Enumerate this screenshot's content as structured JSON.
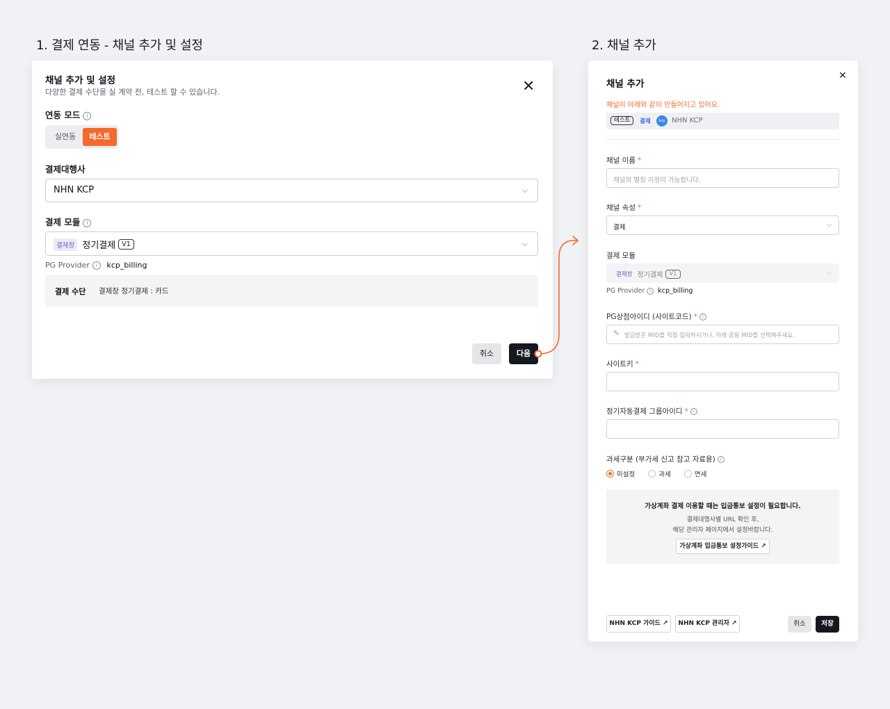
{
  "steps": {
    "step1_title": "1. 결제 연동 - 채널 추가 및 설정",
    "step2_title": "2. 채널 추가"
  },
  "card1": {
    "title": "채널 추가 및 설정",
    "subtitle": "다양한 결제 수단을 실 계약 전, 테스트 할 수 있습니다.",
    "close": "✕",
    "mode_label": "연동 모드",
    "mode_options": [
      "실연동",
      "테스트"
    ],
    "mode_selected": "테스트",
    "pg_label": "결제대행사",
    "pg_value": "NHN KCP",
    "module_label": "결제 모듈",
    "module_tag": "결제창",
    "module_value": "정기결제",
    "module_version": "V1",
    "provider_label": "PG Provider",
    "provider_value": "kcp_billing",
    "method_key": "결제 수단",
    "method_value": "결제창 정기결제 : 카드",
    "cancel": "취소",
    "next": "다음"
  },
  "card2": {
    "title": "채널 추가",
    "close": "✕",
    "warn": "채널이 아래와 같이 만들어지고 있어요.",
    "preview": {
      "mode": "테스트",
      "type": "결제",
      "logo": "kcp",
      "pg": "NHN KCP"
    },
    "name_label": "채널 이름",
    "name_placeholder": "채널의 별칭 지정이 가능합니다.",
    "attr_label": "채널 속성",
    "attr_value": "결제",
    "module_label": "결제 모듈",
    "module_tag": "결제창",
    "module_value": "정기결제",
    "module_version": "V1",
    "provider_label": "PG Provider",
    "provider_value": "kcp_billing",
    "mid_label": "PG상점아이디 (사이트코드)",
    "mid_placeholder": "발급받은 MID를 직접 입력하시거나, 아래 공용 MID를 선택해주세요.",
    "sitekey_label": "사이트키",
    "group_label": "정기자동결제 그룹아이디",
    "tax_label": "과세구분 (부가세 신고 참고 자료용)",
    "tax_options": [
      "미설정",
      "과세",
      "면세"
    ],
    "tax_selected": "미설정",
    "notice_title": "가상계좌 결제 이용할 때는 입금통보 설정이 필요합니다.",
    "notice_line1": "결제대행사별 URL 확인 후,",
    "notice_line2": "해당 관리자 페이지에서 설정바랍니다.",
    "notice_button": "가상계좌 입금통보 설정가이드 ↗",
    "guide_button": "NHN KCP 가이드 ↗",
    "admin_button": "NHN KCP 관리자 ↗",
    "cancel": "취소",
    "save": "저장"
  },
  "colors": {
    "accent": "#f46a2d",
    "dark": "#16181f",
    "required": "#f06b2c"
  },
  "icons": [
    "close-icon",
    "info-icon",
    "chevron-down-icon",
    "pencil-icon",
    "external-link-icon"
  ]
}
